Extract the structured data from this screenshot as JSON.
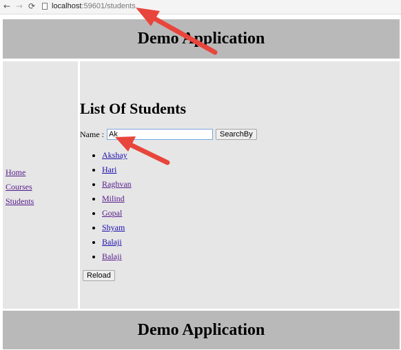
{
  "browser": {
    "back_icon": "←",
    "forward_icon": "→",
    "reload_icon": "⟳",
    "url_host": "localhost",
    "url_rest": ":59601/students"
  },
  "header": {
    "title": "Demo Application"
  },
  "sidebar": {
    "items": [
      {
        "label": "Home"
      },
      {
        "label": "Courses"
      },
      {
        "label": "Students"
      }
    ]
  },
  "main": {
    "heading": "List Of Students",
    "search_label": "Name :",
    "search_value": "Ak",
    "search_button": "SearchBy",
    "students": [
      "Akshay",
      "Hari",
      "Raghvan",
      "Milind",
      "Gopal",
      "Shyam",
      "Balaji",
      "Balaji"
    ],
    "reload_button": "Reload"
  },
  "footer": {
    "title": "Demo Application"
  },
  "colors": {
    "annotation_arrow": "#e8453c",
    "header_bg": "#b9b9b9",
    "panel_bg": "#e6e6e6"
  }
}
